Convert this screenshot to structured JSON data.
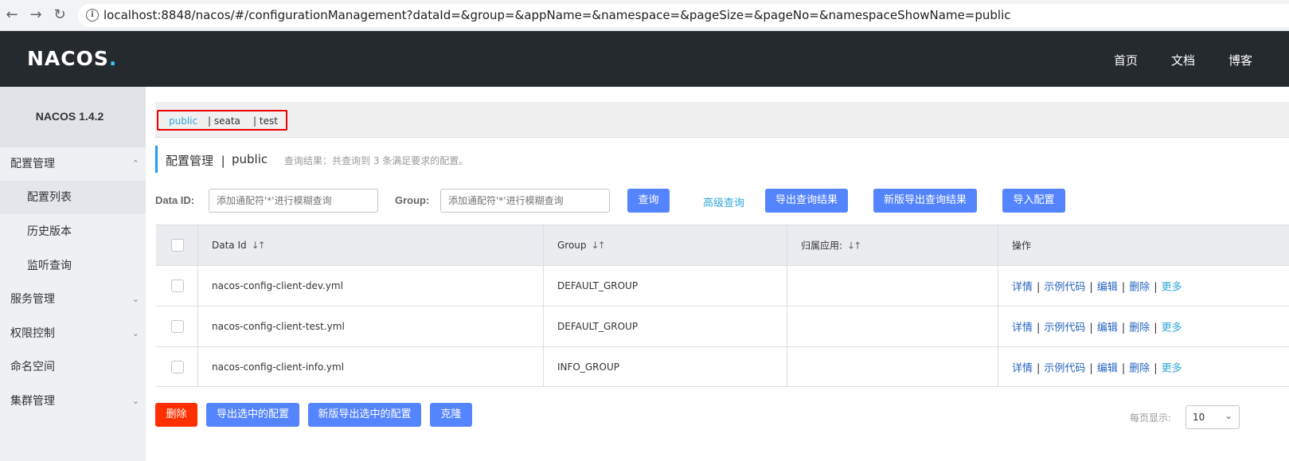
{
  "browser": {
    "url": "localhost:8848/nacos/#/configurationManagement?dataId=&group=&appName=&namespace=&pageSize=&pageNo=&namespaceShowName=public",
    "back_icon": "arrow-left-icon",
    "forward_icon": "arrow-right-icon",
    "reload_icon": "reload-icon"
  },
  "header": {
    "logo": "NACOS.",
    "links": [
      "首页",
      "文档",
      "博客"
    ]
  },
  "sidebar": {
    "version": "NACOS 1.4.2",
    "items": [
      {
        "label": "配置管理"
      },
      {
        "label": "配置列表"
      },
      {
        "label": "历史版本"
      },
      {
        "label": "监听查询"
      },
      {
        "label": "服务管理"
      },
      {
        "label": "权限控制"
      },
      {
        "label": "命名空间"
      },
      {
        "label": "集群管理"
      }
    ]
  },
  "namespaces": [
    {
      "label": "public",
      "active": true
    },
    {
      "label": "| seata"
    },
    {
      "label": "| test"
    }
  ],
  "title": {
    "section": "配置管理",
    "separator": "|",
    "namespace": "public",
    "result": "查询结果：共查询到 3 条满足要求的配置。"
  },
  "search": {
    "data_id_label": "Data ID:",
    "data_id_placeholder": "添加通配符'*'进行模糊查询",
    "group_label": "Group:",
    "group_placeholder": "添加通配符'*'进行模糊查询",
    "query_button": "查询",
    "advanced_query": "高级查询",
    "export_button": "导出查询结果",
    "export_new_button": "新版导出查询结果",
    "import_button": "导入配置"
  },
  "table": {
    "headers": [
      "Data Id",
      "Group",
      "归属应用:",
      "操作"
    ],
    "rows": [
      {
        "data_id": "nacos-config-client-dev.yml",
        "group": "DEFAULT_GROUP",
        "app": ""
      },
      {
        "data_id": "nacos-config-client-test.yml",
        "group": "DEFAULT_GROUP",
        "app": ""
      },
      {
        "data_id": "nacos-config-client-info.yml",
        "group": "INFO_GROUP",
        "app": ""
      }
    ],
    "ops": {
      "detail": "详情",
      "sample": "示例代码",
      "edit": "编辑",
      "delete": "删除",
      "more": "更多",
      "sep": "|"
    }
  },
  "footer": {
    "delete_button": "删除",
    "export_selected_button": "导出选中的配置",
    "export_selected_new_button": "新版导出选中的配置",
    "clone_button": "克隆",
    "page_size_label": "每页显示:",
    "page_size_value": "10"
  }
}
